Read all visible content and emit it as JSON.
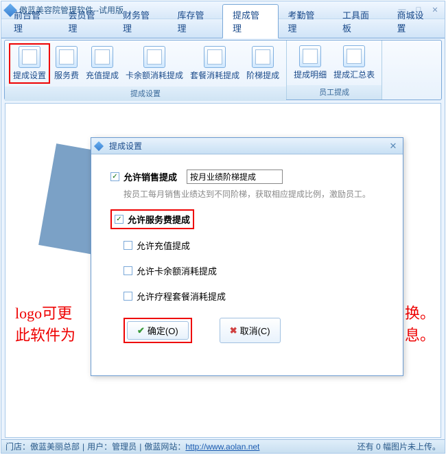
{
  "window": {
    "title": "傲蓝美容院管理软件--试用版"
  },
  "tabs": [
    {
      "label": "前台管理"
    },
    {
      "label": "会员管理"
    },
    {
      "label": "财务管理"
    },
    {
      "label": "库存管理"
    },
    {
      "label": "提成管理"
    },
    {
      "label": "考勤管理"
    },
    {
      "label": "工具面板"
    },
    {
      "label": "商城设置"
    }
  ],
  "active_tab_index": 4,
  "ribbon": {
    "groups": [
      {
        "title": "提成设置",
        "items": [
          {
            "label": "提成设置",
            "highlighted": true
          },
          {
            "label": "服务费"
          },
          {
            "label": "充值提成"
          },
          {
            "label": "卡余额消耗提成"
          },
          {
            "label": "套餐消耗提成"
          },
          {
            "label": "阶梯提成"
          }
        ]
      },
      {
        "title": "员工提成",
        "items": [
          {
            "label": "提成明细"
          },
          {
            "label": "提成汇总表"
          }
        ]
      }
    ]
  },
  "background_text": {
    "line1": "logo可更",
    "line2": "此软件为",
    "suffix1": "换。",
    "suffix2": "息。"
  },
  "dialog": {
    "title": "提成设置",
    "options": [
      {
        "label": "允许销售提成",
        "checked": true,
        "bold": true,
        "select_value": "按月业绩阶梯提成"
      },
      {
        "label": "允许服务费提成",
        "checked": true,
        "bold": true,
        "highlighted": true
      },
      {
        "label": "允许充值提成",
        "checked": false
      },
      {
        "label": "允许卡余额消耗提成",
        "checked": false
      },
      {
        "label": "允许疗程套餐消耗提成",
        "checked": false
      }
    ],
    "help_text": "按员工每月销售业绩达到不同阶梯，获取相应提成比例，激励员工。",
    "ok_label": "确定(O)",
    "cancel_label": "取消(C)"
  },
  "statusbar": {
    "store_prefix": "门店：",
    "store": "傲蓝美丽总部",
    "user_prefix": "用户：",
    "user": "管理员",
    "site_prefix": "傲蓝网站：",
    "site_url": "http://www.aolan.net",
    "right_text": "还有 0 幅图片未上传。"
  }
}
